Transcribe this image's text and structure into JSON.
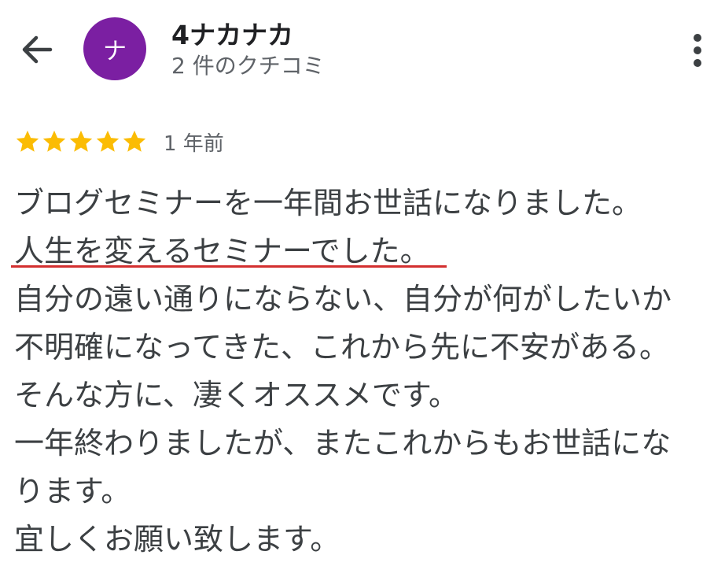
{
  "header": {
    "back_icon": "arrow-left-icon",
    "avatar_letter": "ナ",
    "avatar_color": "#7b1fa2",
    "reviewer_name": "4ナカナカ",
    "review_count": "2 件のクチコミ",
    "more_icon": "more-vert-icon"
  },
  "review": {
    "rating": 5,
    "max_rating": 5,
    "star_color": "#fbbc04",
    "date": "1 年前",
    "lines": [
      "ブログセミナーを一年間お世話になりました。",
      "人生を変えるセミナーでした。",
      "自分の遠い通りにならない、自分が何がしたいか",
      "不明確になってきた、これから先に不安がある。",
      "そんな方に、凄くオススメです。",
      "一年終わりましたが、またこれからもお世話にな",
      "ります。",
      "宜しくお願い致します。"
    ]
  },
  "annotation": {
    "underline_color": "#d32f2f"
  }
}
